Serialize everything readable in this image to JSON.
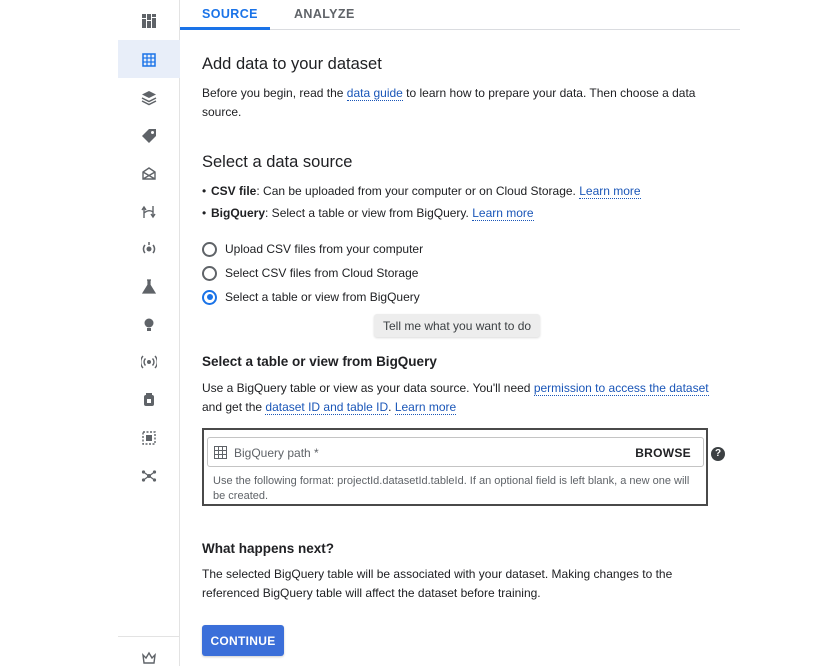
{
  "tabs": [
    {
      "label": "SOURCE",
      "active": true
    },
    {
      "label": "ANALYZE",
      "active": false
    }
  ],
  "rail": {
    "icons": [
      "dashboard-icon",
      "datasets-icon",
      "features-icon",
      "labeling-icon",
      "workbench-icon",
      "pipelines-icon",
      "training-icon",
      "experiments-icon",
      "models-icon",
      "endpoints-icon",
      "batch-predictions-icon",
      "metadata-icon",
      "matching-engine-icon",
      "marketplace-icon"
    ],
    "active_index": 1
  },
  "intro": {
    "title": "Add data to your dataset",
    "text_before": "Before you begin, read the ",
    "link": "data guide",
    "text_after": " to learn how to prepare your data. Then choose a data source."
  },
  "source": {
    "title": "Select a data source",
    "bullets": [
      {
        "bold": "CSV file",
        "text": ": Can be uploaded from your computer or on Cloud Storage. ",
        "link": "Learn more"
      },
      {
        "bold": "BigQuery",
        "text": ": Select a table or view from BigQuery. ",
        "link": "Learn more"
      }
    ],
    "options": [
      {
        "label": "Upload CSV files from your computer",
        "checked": false
      },
      {
        "label": "Select CSV files from Cloud Storage",
        "checked": false
      },
      {
        "label": "Select a table or view from BigQuery",
        "checked": true
      }
    ],
    "tooltip": "Tell me what you want to do"
  },
  "bigquery": {
    "title": "Select a table or view from BigQuery",
    "text1": "Use a BigQuery table or view as your data source. You'll need ",
    "link1": "permission to access the dataset",
    "text2": "and get the ",
    "link2": "dataset ID and table ID",
    "text3": ". ",
    "link3": "Learn more",
    "field_placeholder": "BigQuery path *",
    "browse_label": "BROWSE",
    "help": "?",
    "hint": "Use the following format: projectId.datasetId.tableId. If an optional field is left blank, a new one will be created."
  },
  "next": {
    "title": "What happens next?",
    "text": "The selected BigQuery table will be associated with your dataset. Making changes to the referenced BigQuery table will affect the dataset before training."
  },
  "continue_label": "CONTINUE",
  "colors": {
    "accent": "#1a73e8",
    "button": "#3b6fd9",
    "link": "#1a56b8"
  }
}
